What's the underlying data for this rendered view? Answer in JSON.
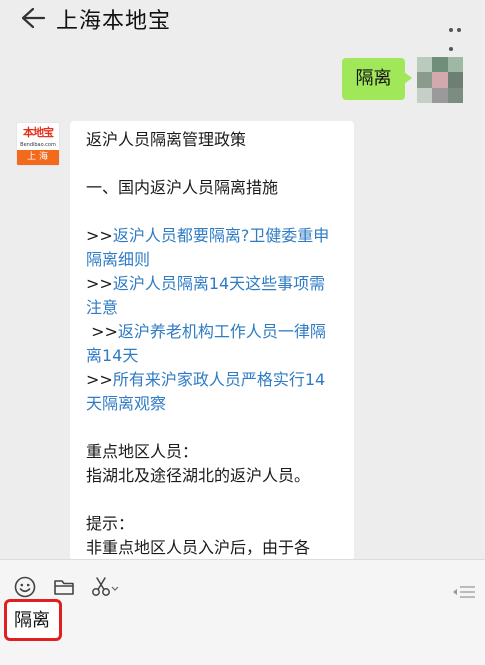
{
  "header": {
    "back_icon": "back-arrow-icon",
    "title": "上海本地宝",
    "more_icon": "more-dots-icon"
  },
  "outgoing": {
    "text": "隔离"
  },
  "sender": {
    "logo_top": "本地宝",
    "logo_sub": "Bendibao.com",
    "logo_city": "上海"
  },
  "incoming": {
    "title": "返沪人员隔离管理政策",
    "section1": "一、国内返沪人员隔离措施",
    "links": [
      {
        "prefix": ">>",
        "text": "返沪人员都要隔离?卫健委重申隔离细则"
      },
      {
        "prefix": ">>",
        "text": "返沪人员隔离14天这些事项需注意"
      },
      {
        "prefix": " >>",
        "text": "返沪养老机构工作人员一律隔离14天"
      },
      {
        "prefix": ">>",
        "text": "所有来沪家政人员严格实行14天隔离观察"
      }
    ],
    "key_area_label": "重点地区人员：",
    "key_area_text": "指湖北及途径湖北的返沪人员。",
    "tip_label": "提示：",
    "tip_text": "非重点地区人员入沪后，由于各"
  },
  "input": {
    "value": "隔离"
  },
  "toolbar": {
    "emoji_icon": "emoji-icon",
    "folder_icon": "folder-icon",
    "scissors_icon": "scissors-icon",
    "list_icon": "list-icon"
  }
}
